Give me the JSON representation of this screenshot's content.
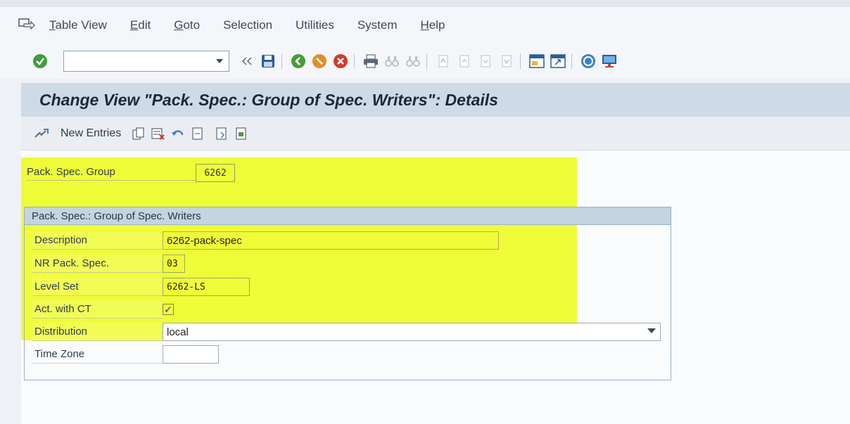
{
  "menu": {
    "items": [
      {
        "underline": "T",
        "rest": "able View"
      },
      {
        "underline": "E",
        "rest": "dit"
      },
      {
        "underline": "G",
        "rest": "oto"
      },
      {
        "underline": "",
        "rest": "Selection"
      },
      {
        "underline": "",
        "rest": "Utilities"
      },
      {
        "underline": "",
        "rest": "System"
      },
      {
        "underline": "H",
        "rest": "elp"
      }
    ]
  },
  "toolbar": {
    "command_field_value": ""
  },
  "page": {
    "title": "Change View \"Pack. Spec.: Group of Spec. Writers\": Details"
  },
  "app_toolbar": {
    "new_entries_label": "New Entries"
  },
  "form": {
    "pack_spec_group_label": "Pack. Spec. Group",
    "pack_spec_group_value": "6262",
    "group_title": "Pack. Spec.: Group of Spec. Writers",
    "description_label": "Description",
    "description_value": "6262-pack-spec",
    "nr_pack_spec_label": "NR Pack. Spec.",
    "nr_pack_spec_value": "03",
    "level_set_label": "Level Set",
    "level_set_value": "6262-LS",
    "act_with_ct_label": "Act. with CT",
    "act_with_ct_checked": "✓",
    "distribution_label": "Distribution",
    "distribution_value": "local",
    "time_zone_label": "Time Zone",
    "time_zone_value": ""
  },
  "colors": {
    "highlight": "#ecfc00",
    "title_bar": "#cfdae7",
    "group_header": "#c6d3e0"
  }
}
